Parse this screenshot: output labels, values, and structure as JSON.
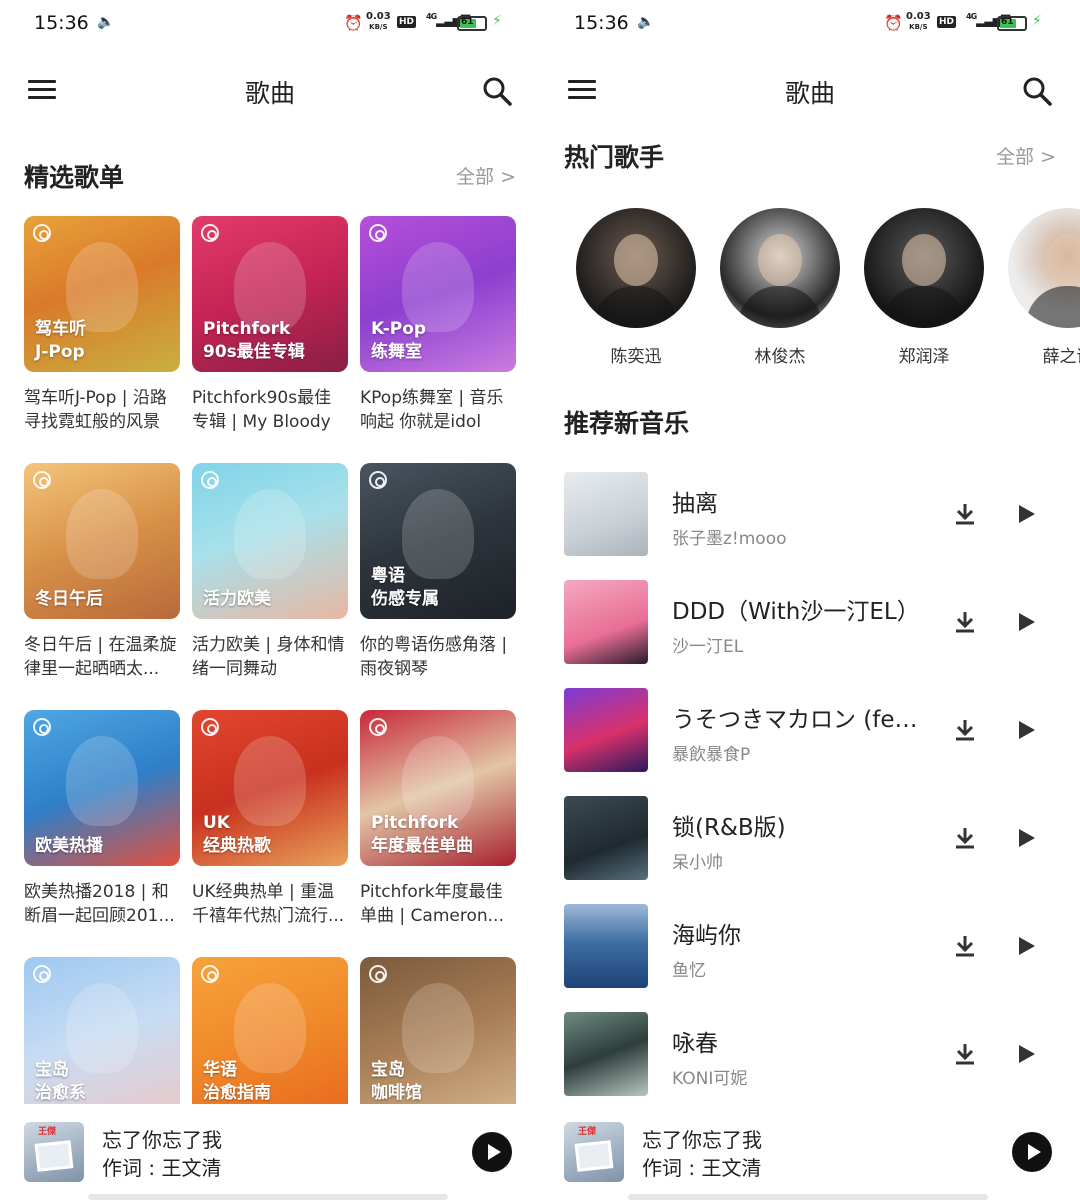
{
  "status_bar": {
    "time": "15:36",
    "net_speed_value": "0.03",
    "net_speed_unit": "KB/S",
    "hd": "HD",
    "signal": "4G",
    "battery": "61"
  },
  "header": {
    "title": "歌曲"
  },
  "left": {
    "section_title": "精选歌单",
    "more_label": "全部 >",
    "playlists": [
      {
        "cover_text": "驾车听\nJ-Pop",
        "name": "驾车听J-Pop | 沿路寻找霓虹般的风景",
        "bg": "linear-gradient(160deg,#e8a23a,#d97a2a 45%,#c8b040)"
      },
      {
        "cover_text": "Pitchfork\n90s最佳专辑",
        "name": "Pitchfork90s最佳专辑 | My Bloody ...",
        "bg": "linear-gradient(160deg,#e23b6a,#c42455 50%,#8a1f44)"
      },
      {
        "cover_text": "K-Pop\n练舞室",
        "name": "KPop练舞室 | 音乐响起 你就是idol",
        "bg": "linear-gradient(160deg,#b54fd9,#8d3fcf 50%,#c97de0)"
      },
      {
        "cover_text": "冬日午后",
        "name": "冬日午后 | 在温柔旋律里一起晒晒太...",
        "bg": "linear-gradient(160deg,#f3c57a,#d89048 50%,#b86a3a)"
      },
      {
        "cover_text": "活力欧美",
        "name": "活力欧美 | 身体和情绪一同舞动",
        "bg": "linear-gradient(160deg,#7fd4e8,#a8e0ea 45%,#e9b7a3)"
      },
      {
        "cover_text": "粤语\n伤感专属",
        "name": "你的粤语伤感角落 | 雨夜钢琴",
        "bg": "linear-gradient(160deg,#4a5560,#2d343b 50%,#1d2228)"
      },
      {
        "cover_text": "欧美热播",
        "name": "欧美热播2018 | 和断眉一起回顾201...",
        "bg": "linear-gradient(160deg,#4fa7e3,#2f7fc8 50%,#e3503d)"
      },
      {
        "cover_text": "UK\n经典热歌",
        "name": "UK经典热单 | 重温千禧年代热门流行...",
        "bg": "linear-gradient(160deg,#e2462f,#c8311f 50%,#e9a15b)"
      },
      {
        "cover_text": "Pitchfork\n年度最佳单曲",
        "name": "Pitchfork年度最佳单曲 | Cameron...",
        "bg": "linear-gradient(160deg,#c8283a,#e2c5a6 50%,#a8202e)"
      },
      {
        "cover_text": "宝岛\n治愈系",
        "name": "",
        "bg": "linear-gradient(160deg,#9ec8f0,#c7dcf3 50%,#e9c9c9)"
      },
      {
        "cover_text": "华语\n治愈指南",
        "name": "",
        "bg": "linear-gradient(160deg,#f7a23c,#f08a2a 50%,#e86a1f)"
      },
      {
        "cover_text": "宝岛\n咖啡馆",
        "name": "",
        "bg": "linear-gradient(160deg,#7b5a3c,#a77d55 50%,#d3b28a)"
      }
    ]
  },
  "right": {
    "artists_title": "热门歌手",
    "artists_more": "全部 >",
    "artists": [
      {
        "name": "陈奕迅",
        "bg": "radial-gradient(circle at 50% 40%,#6b5a4e,#1b1b1b 70%)"
      },
      {
        "name": "林俊杰",
        "bg": "radial-gradient(circle at 50% 40%,#d9d9d9,#2a2a2a 65%,#eeeeee)"
      },
      {
        "name": "郑润泽",
        "bg": "radial-gradient(circle at 50% 40%,#595959,#151515 70%)"
      },
      {
        "name": "薛之谦",
        "bg": "radial-gradient(circle at 50% 40%,#c9a58a,#ececec 60%)"
      }
    ],
    "new_music_title": "推荐新音乐",
    "songs": [
      {
        "title": "抽离",
        "artist": "张子墨z!mooo",
        "bg": "linear-gradient(160deg,#e8ecef,#c9d0d6 60%,#aab3bb)"
      },
      {
        "title": "DDD（With沙一汀EL）",
        "artist": "沙一汀EL",
        "bg": "linear-gradient(160deg,#f3a9c0,#e96e96 60%,#2a1b2b)"
      },
      {
        "title": "うそつきマカロン (feat. 初音ミク)",
        "artist": "暴飲暴食P",
        "bg": "linear-gradient(160deg,#7c3cd6,#d9316a 55%,#2b1a5e)"
      },
      {
        "title": "锁(R&B版)",
        "artist": "呆小帅",
        "bg": "linear-gradient(160deg,#3c4a52,#1f2a30 60%,#56707c)"
      },
      {
        "title": "海屿你",
        "artist": "鱼忆",
        "bg": "linear-gradient(180deg,#9fb8d8,#3e6fa4 45%,#1f4378)"
      },
      {
        "title": "咏春",
        "artist": "KONI可妮",
        "bg": "linear-gradient(160deg,#6f8a82,#2d3e3c 50%,#b7c6c0)"
      }
    ]
  },
  "player": {
    "title": "忘了你忘了我",
    "subtitle": "作词 : 王文清",
    "cover_tag": "王傑"
  },
  "colors": {
    "accent_battery": "#3bc254",
    "text_primary": "#222222",
    "text_secondary": "#888888"
  }
}
